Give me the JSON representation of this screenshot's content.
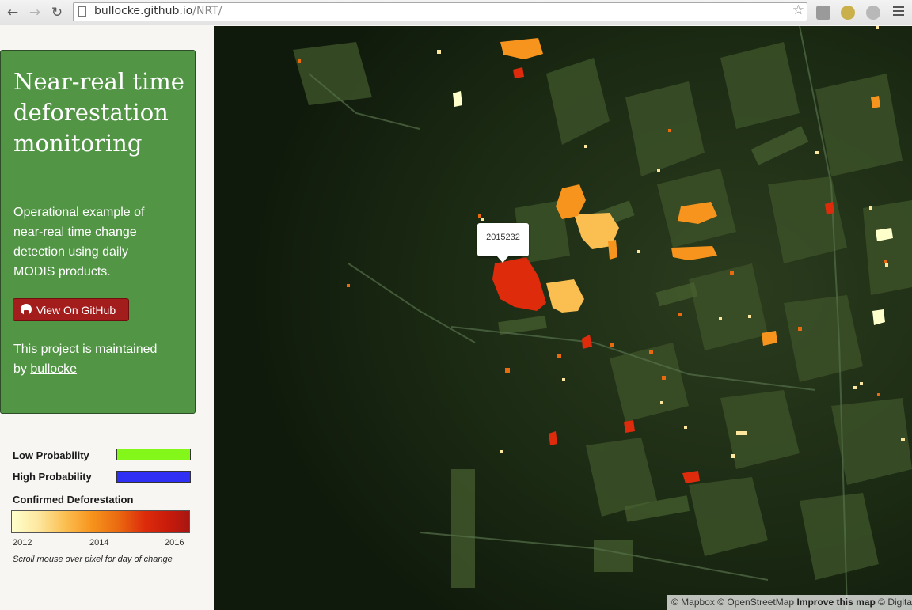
{
  "browser": {
    "url_domain": "bullocke.github.io",
    "url_path": "/NRT/",
    "icons": [
      "back-icon",
      "forward-icon",
      "reload-icon",
      "page-icon",
      "star-icon",
      "extension-icon",
      "menu-icon"
    ]
  },
  "sidebar": {
    "title": "Near-real time deforestation monitoring",
    "description": "Operational example of near-real time change detection using daily MODIS products.",
    "github_button": "View On GitHub",
    "maintained_text": "This project is maintained by",
    "maintainer": "bullocke"
  },
  "legend": {
    "low_label": "Low Probability",
    "low_color": "#84f71a",
    "high_label": "High Probability",
    "high_color": "#3030f5",
    "confirmed_label": "Confirmed Deforestation",
    "ramp_colors": [
      "#ffffcc",
      "#fbbf51",
      "#f7941d",
      "#dd2b0b",
      "#a81612"
    ],
    "ticks": [
      "2012",
      "2014",
      "2016"
    ],
    "hint": "Scroll mouse over pixel for day of change"
  },
  "map": {
    "popup_value": "2015232",
    "attribution_mapbox": "© Mapbox",
    "attribution_osm": "© OpenStreetMap",
    "attribution_improve": "Improve this map",
    "attribution_digital": "© Digita"
  }
}
